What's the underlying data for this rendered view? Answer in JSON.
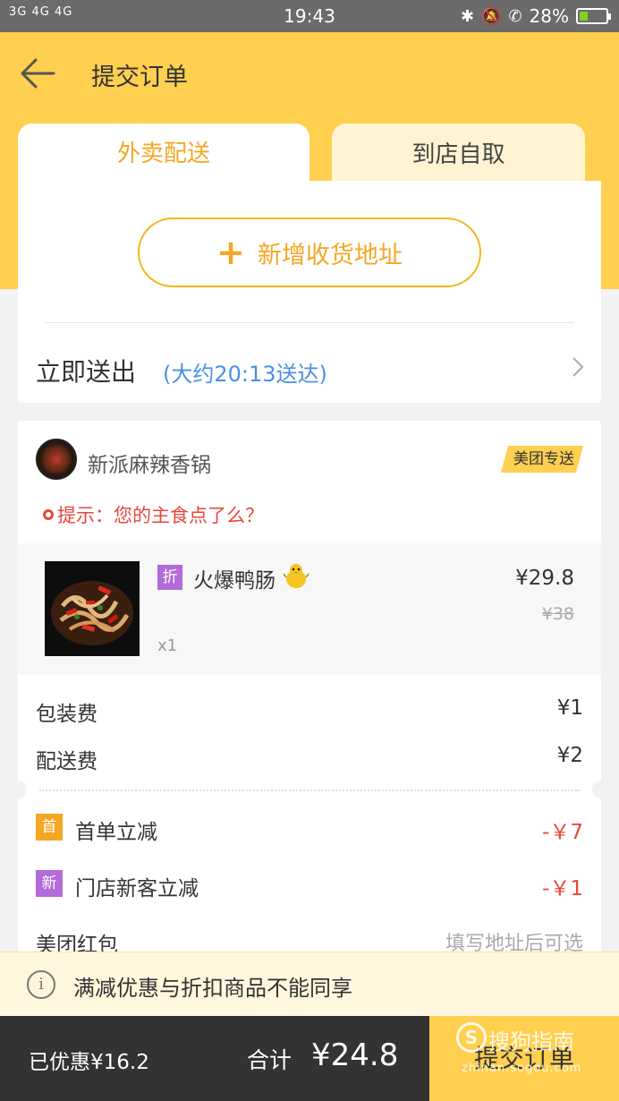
{
  "status_bar": {
    "signal": "3G 4G 4G",
    "time": "19:43",
    "icons": [
      "bluetooth-icon",
      "mute-icon",
      "hd-call-icon"
    ],
    "battery": "28%"
  },
  "header": {
    "title": "提交订单"
  },
  "tabs": [
    {
      "label": "外卖配送",
      "active": true
    },
    {
      "label": "到店自取",
      "active": false
    }
  ],
  "address": {
    "add_label": "新增收货地址",
    "send_now": "立即送出",
    "eta": "(大约20:13送达)"
  },
  "shop": {
    "name": "新派麻辣香锅",
    "badge": "美团专送",
    "tip": "提示：您的主食点了么？"
  },
  "item": {
    "tag": "折",
    "name": "火爆鸭肠",
    "qty": "x1",
    "price": "¥29.8",
    "original_price": "¥38"
  },
  "fees": [
    {
      "label": "包装费",
      "value": "¥1"
    },
    {
      "label": "配送费",
      "value": "¥2"
    }
  ],
  "promos": [
    {
      "tag": "首",
      "label": "首单立减",
      "value": "-￥7",
      "color": "#f5a623"
    },
    {
      "tag": "新",
      "label": "门店新客立减",
      "value": "-￥1",
      "color": "#b36bd9"
    }
  ],
  "red_packet": {
    "label": "美团红包",
    "hint": "填写地址后可选"
  },
  "notice": {
    "text": "满减优惠与折扣商品不能同享"
  },
  "footer": {
    "saved": "已优惠¥16.2",
    "total_label": "合计",
    "total": "¥24.8",
    "submit": "提交订单"
  },
  "watermark": {
    "main": "搜狗指南",
    "sub": "zhinan.sogou.com"
  },
  "colors": {
    "brand_yellow": "#ffcf4f",
    "accent_orange": "#f5a623",
    "link_blue": "#4a90e2",
    "alert_red": "#e8473b"
  }
}
